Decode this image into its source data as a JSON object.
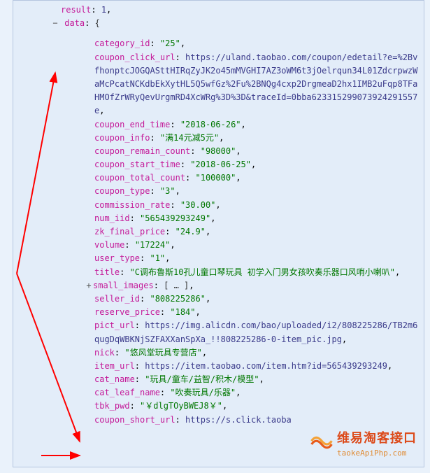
{
  "root": {
    "result_key": "result",
    "result_val": "1",
    "data_key": "data",
    "data_open": "{"
  },
  "fields": {
    "category_id": {
      "key": "category_id",
      "val": "\"25\""
    },
    "coupon_click_url": {
      "key": "coupon_click_url",
      "url": "https://uland.taobao.com/coupon/edetail?e=%2BvfhonptcJOGQASttHIRqZyJK2o45mMVGHI7AZ3oWM6t3jOelrqun34L01ZdcrpwzWaMcPcatNCKdbEkXytHL5Q5wfGz%2Fu%2BNQg4cxp2DrgmeaD2hx1IMB2uFqp8TFaHMOfZrWRyQevUrgmRD4XcWRg%3D%3D&traceId=0bba623315299073924291557e"
    },
    "coupon_end_time": {
      "key": "coupon_end_time",
      "val": "\"2018-06-26\""
    },
    "coupon_info": {
      "key": "coupon_info",
      "val": "\"满14元减5元\""
    },
    "coupon_remain_count": {
      "key": "coupon_remain_count",
      "val": "\"98000\""
    },
    "coupon_start_time": {
      "key": "coupon_start_time",
      "val": "\"2018-06-25\""
    },
    "coupon_total_count": {
      "key": "coupon_total_count",
      "val": "\"100000\""
    },
    "coupon_type": {
      "key": "coupon_type",
      "val": "\"3\""
    },
    "commission_rate": {
      "key": "commission_rate",
      "val": "\"30.00\""
    },
    "num_iid": {
      "key": "num_iid",
      "val": "\"565439293249\""
    },
    "zk_final_price": {
      "key": "zk_final_price",
      "val": "\"24.9\""
    },
    "volume": {
      "key": "volume",
      "val": "\"17224\""
    },
    "user_type": {
      "key": "user_type",
      "val": "\"1\""
    },
    "title": {
      "key": "title",
      "val": "\"C调布鲁斯10孔儿童口琴玩具 初学入门男女孩吹奏乐器口风哨小喇叭\""
    },
    "small_images": {
      "key": "small_images",
      "val": "[ … ]"
    },
    "seller_id": {
      "key": "seller_id",
      "val": "\"808225286\""
    },
    "reserve_price": {
      "key": "reserve_price",
      "val": "\"184\""
    },
    "pict_url": {
      "key": "pict_url",
      "url": "https://img.alicdn.com/bao/uploaded/i2/808225286/TB2m6qugDqWBKNjSZFAXXanSpXa_!!808225286-0-item_pic.jpg"
    },
    "nick": {
      "key": "nick",
      "val": "\"悠风堂玩具专营店\""
    },
    "item_url": {
      "key": "item_url",
      "url": "https://item.taobao.com/item.htm?id=565439293249"
    },
    "cat_name": {
      "key": "cat_name",
      "val": "\"玩具/童车/益智/积木/模型\""
    },
    "cat_leaf_name": {
      "key": "cat_leaf_name",
      "val": "\"吹奏玩具/乐器\""
    },
    "tbk_pwd": {
      "key": "tbk_pwd",
      "val": "\"￥dlgTOyBWEJ8￥\""
    },
    "coupon_short_url": {
      "key": "coupon_short_url",
      "url": "https://s.click.taoba"
    }
  },
  "watermark": {
    "cn": "维易淘客接口",
    "en": "taokeApiPhp.com"
  }
}
